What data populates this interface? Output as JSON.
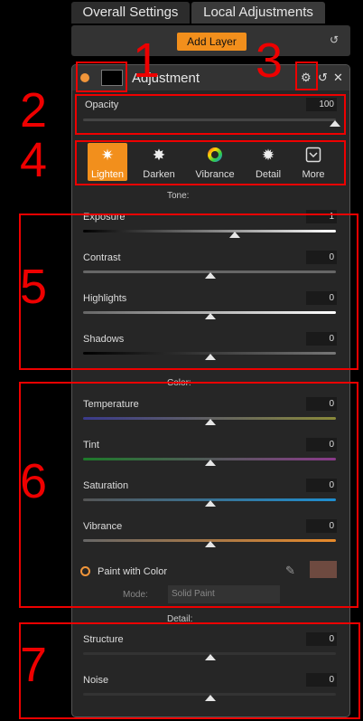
{
  "tabs": [
    {
      "label": "Overall Settings"
    },
    {
      "label": "Local Adjustments"
    }
  ],
  "toolbar": {
    "add_layer_label": "Add Layer",
    "undo_icon": "undo-icon"
  },
  "panel": {
    "title": "Adjustment",
    "opacity": {
      "label": "Opacity",
      "value": "100"
    },
    "presets": [
      {
        "label": "Lighten",
        "icon": "sun-icon",
        "glyph": "✷"
      },
      {
        "label": "Darken",
        "icon": "dark-sun-icon",
        "glyph": "✸"
      },
      {
        "label": "Vibrance",
        "icon": "color-wheel-icon",
        "glyph": ""
      },
      {
        "label": "Detail",
        "icon": "sparkle-icon",
        "glyph": "✹"
      },
      {
        "label": "More",
        "icon": "chevron-down-box-icon",
        "glyph": ""
      }
    ],
    "sections": {
      "tone": "Tone:",
      "color": "Color:",
      "detail": "Detail:"
    },
    "tone_sliders": [
      {
        "label": "Exposure",
        "value": "1"
      },
      {
        "label": "Contrast",
        "value": "0"
      },
      {
        "label": "Highlights",
        "value": "0"
      },
      {
        "label": "Shadows",
        "value": "0"
      }
    ],
    "color_sliders": [
      {
        "label": "Temperature",
        "value": "0"
      },
      {
        "label": "Tint",
        "value": "0"
      },
      {
        "label": "Saturation",
        "value": "0"
      },
      {
        "label": "Vibrance",
        "value": "0"
      }
    ],
    "paint": {
      "label": "Paint with Color",
      "mode_label": "Mode:",
      "mode_value": "Solid Paint",
      "swatch_color": "#6e4a40"
    },
    "detail_sliders": [
      {
        "label": "Structure",
        "value": "0"
      },
      {
        "label": "Noise",
        "value": "0"
      }
    ]
  },
  "annotations": [
    "1",
    "2",
    "3",
    "4",
    "5",
    "6",
    "7"
  ],
  "colors": {
    "accent": "#f28f1c",
    "annotation": "#e00000"
  }
}
